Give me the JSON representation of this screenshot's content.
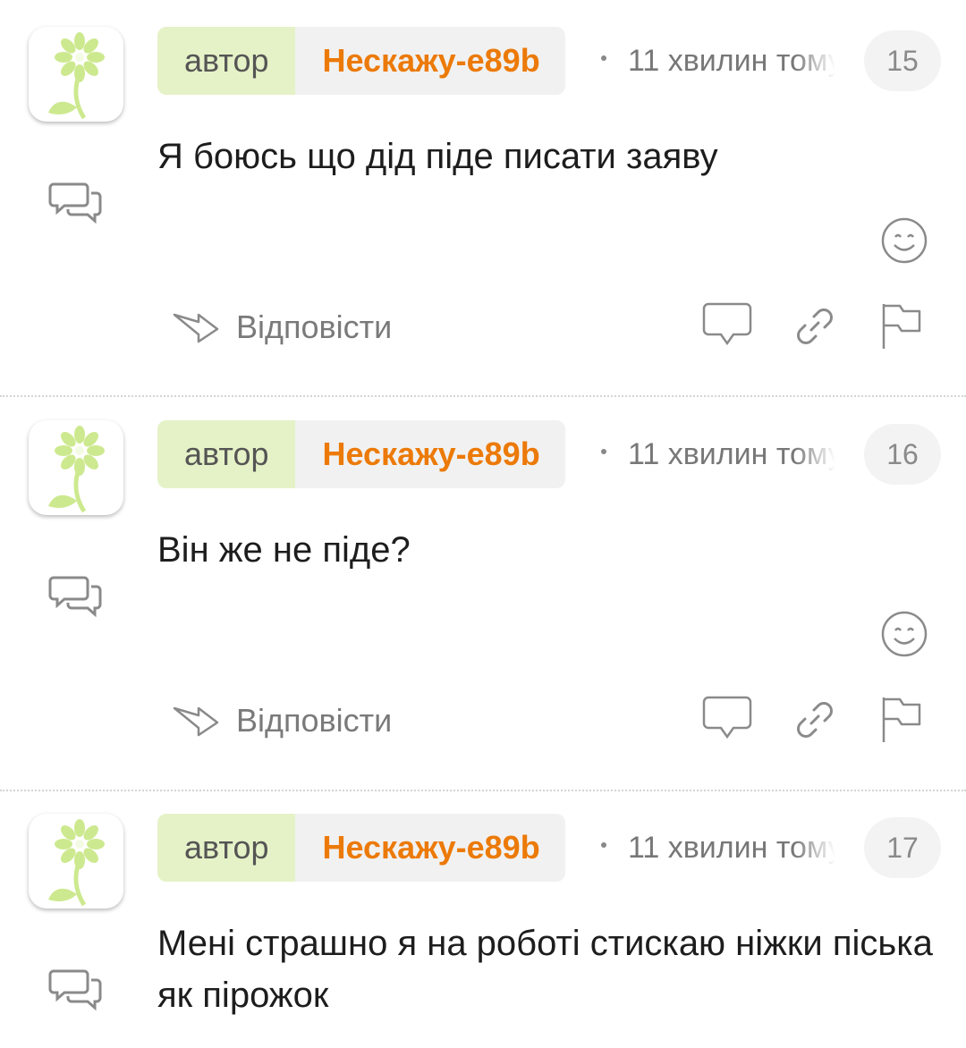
{
  "comments": [
    {
      "role_label": "автор",
      "author": "Нескажу-e89b",
      "time": "11 хвилин тому",
      "number": "15",
      "text": "Я боюсь що дід піде писати заяву",
      "reply_label": "Відповісти"
    },
    {
      "role_label": "автор",
      "author": "Нескажу-e89b",
      "time": "11 хвилин тому",
      "number": "16",
      "text": "Він же не піде?",
      "reply_label": "Відповісти"
    },
    {
      "role_label": "автор",
      "author": "Нескажу-e89b",
      "time": "11 хвилин тому",
      "number": "17",
      "text": "Мені страшно я на роботі стискаю ніжки піська як пірожок"
    }
  ],
  "icons": {
    "avatar": "flower-icon",
    "thread": "chat-bubbles-icon",
    "emoji": "smiley-icon",
    "reply": "reply-arrow-icon",
    "comment": "comment-bubble-icon",
    "link": "link-icon",
    "flag": "flag-icon"
  },
  "colors": {
    "author_name": "#ec7a08",
    "role_bg": "#e5f2c7",
    "flower": "#cde98f"
  }
}
